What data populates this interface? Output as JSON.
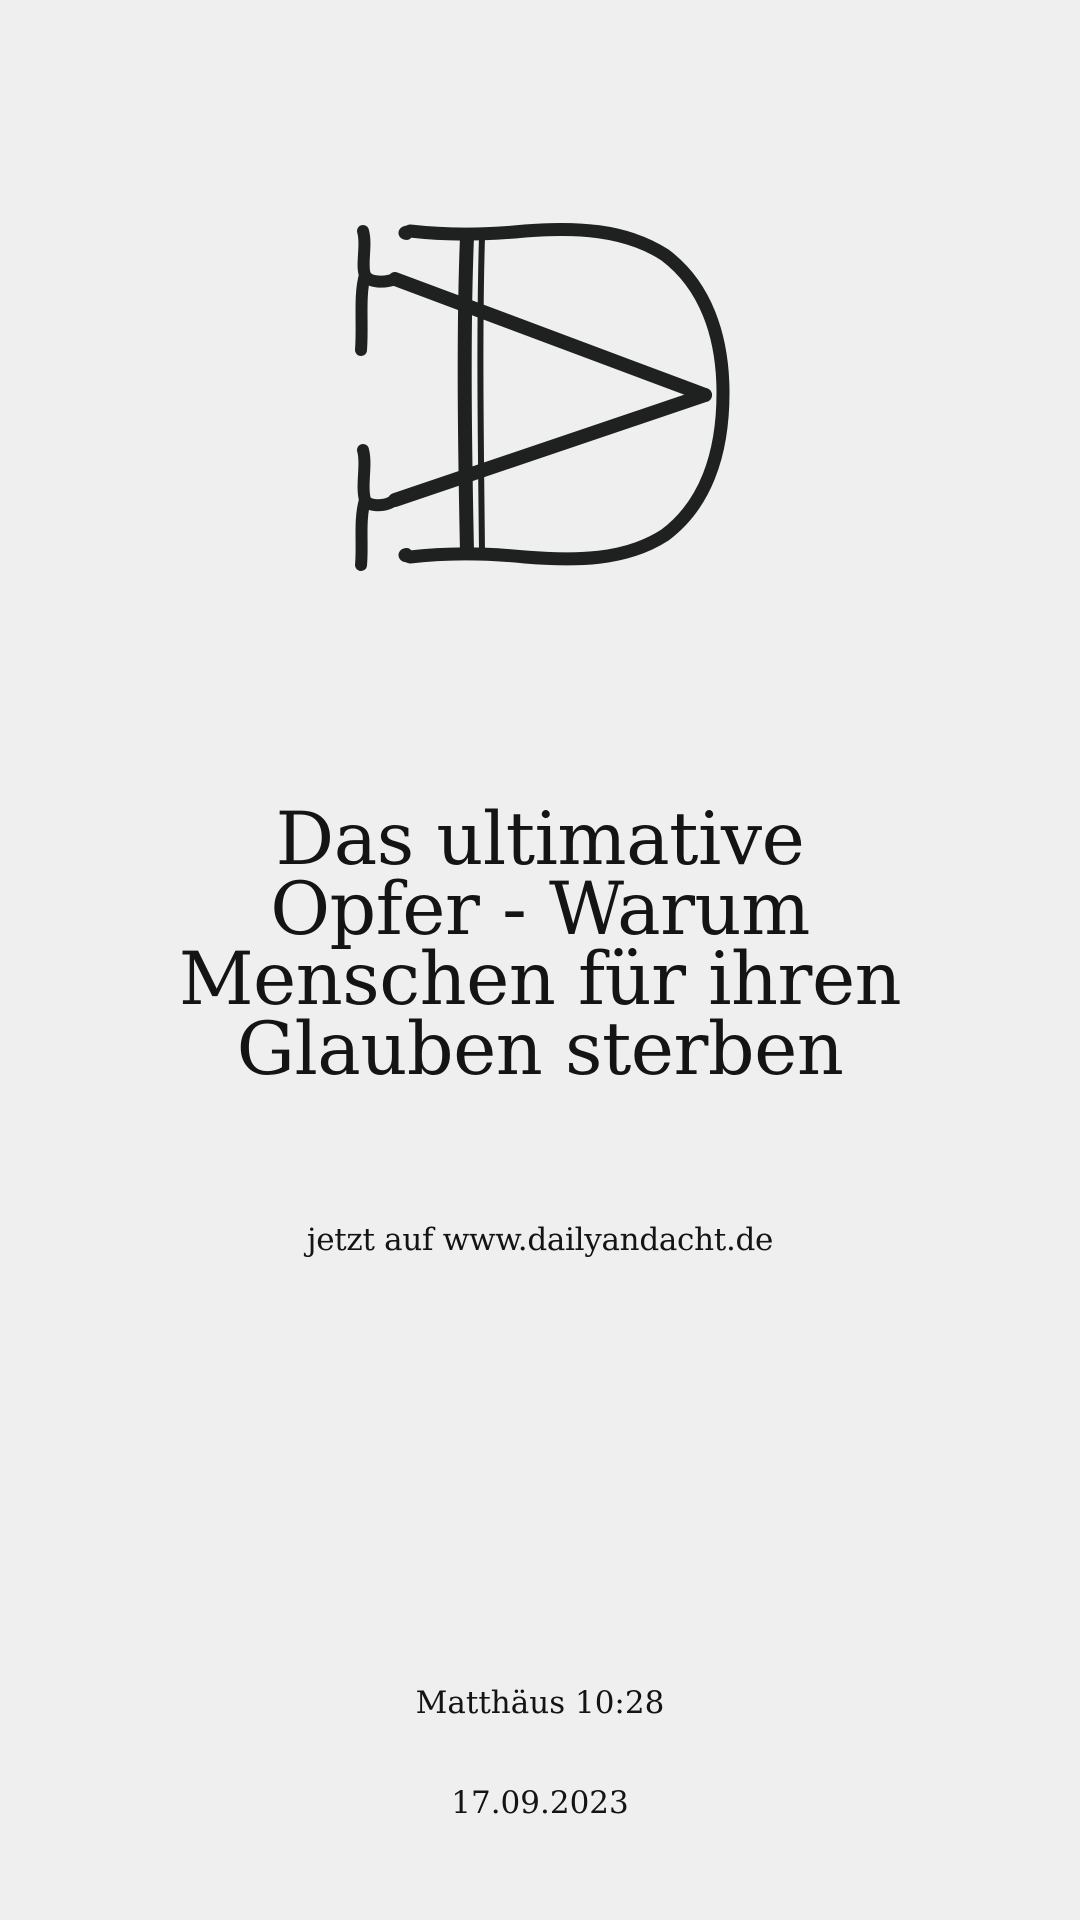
{
  "logo": {
    "icon": "dv-monogram-logo",
    "color": "#1e2120"
  },
  "title": {
    "lines": [
      "Das ultimative",
      "Opfer - Warum",
      "Menschen für ihren",
      "Glauben sterben"
    ]
  },
  "link_text": "jetzt auf www.dailyandacht.de",
  "verse": "Matthäus 10:28",
  "date": "17.09.2023",
  "colors": {
    "background": "#efefef",
    "text": "#141414"
  }
}
